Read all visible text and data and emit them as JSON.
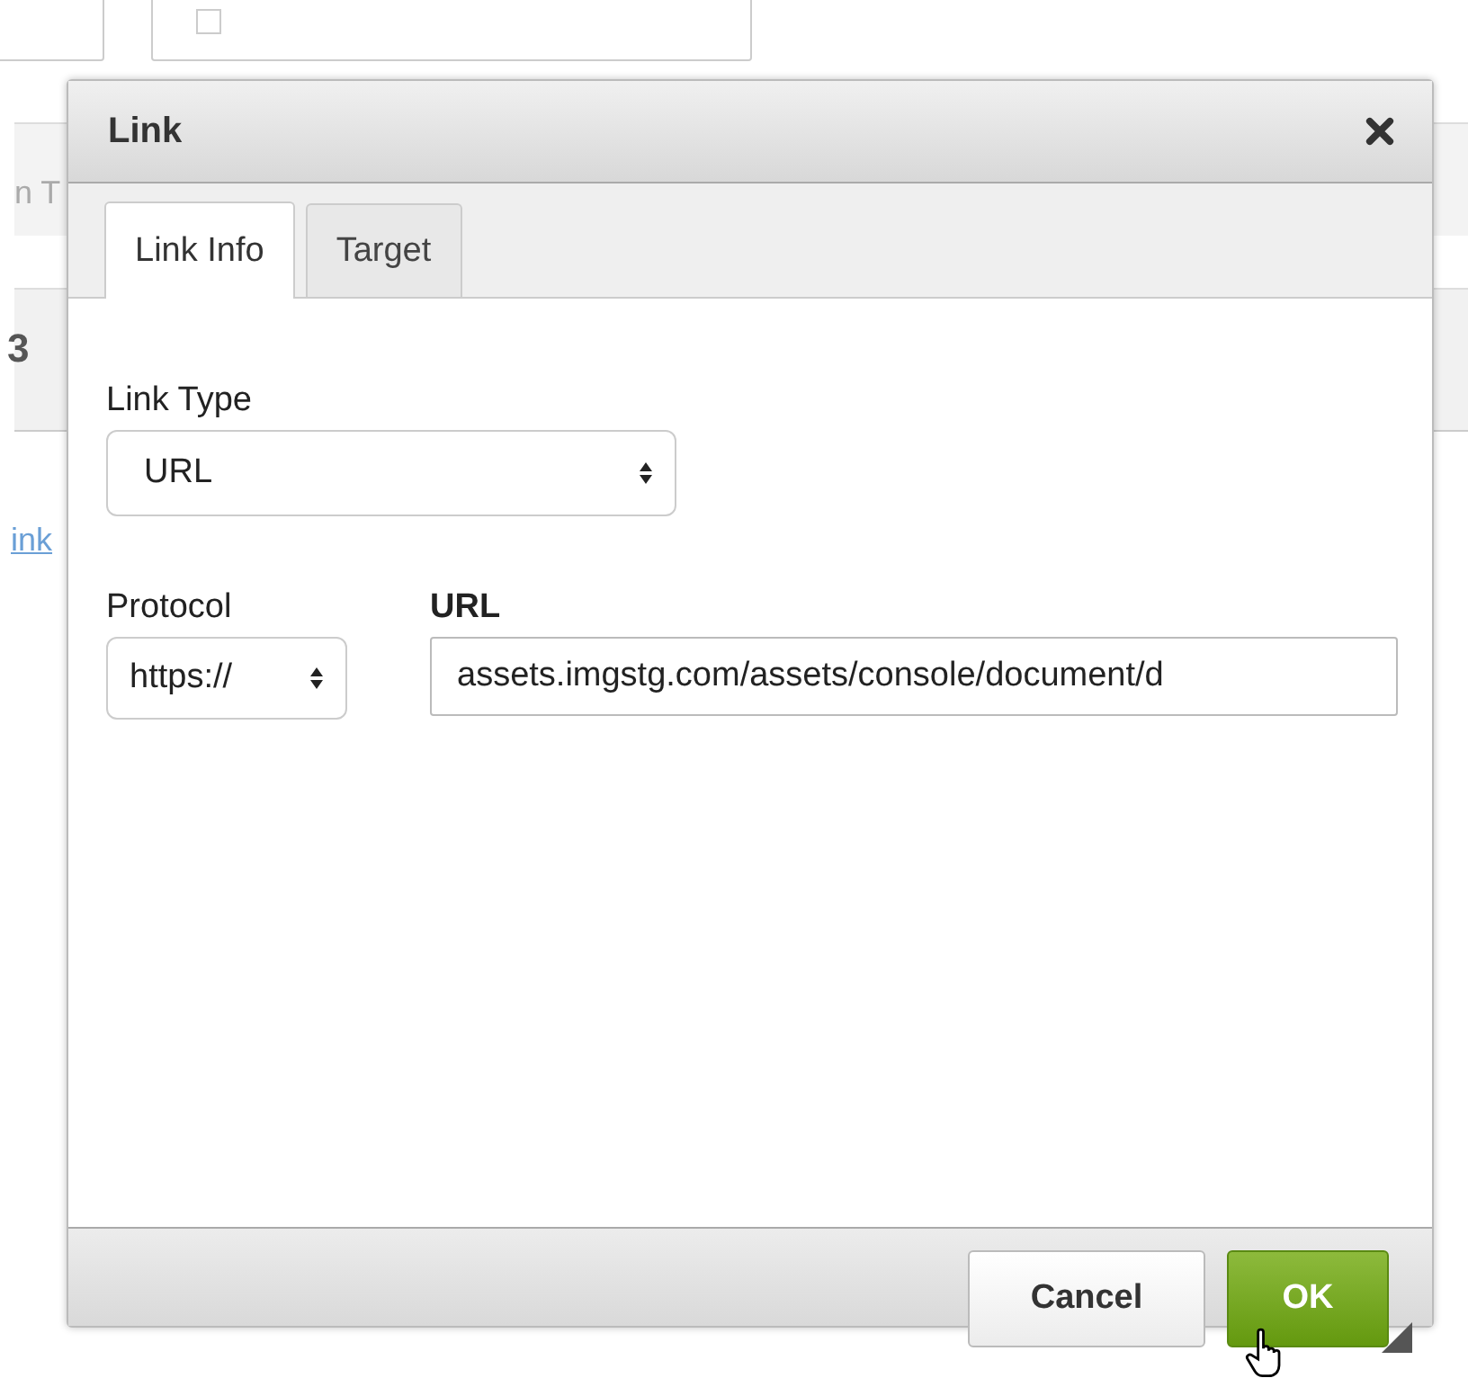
{
  "background": {
    "checkbox": {
      "checked": false
    },
    "toolbar_text": "n T",
    "bold_button": "3",
    "link_text": "ink"
  },
  "dialog": {
    "title": "Link",
    "tabs": [
      {
        "label": "Link Info",
        "selected": true
      },
      {
        "label": "Target",
        "selected": false
      }
    ],
    "link_type": {
      "label": "Link Type",
      "value": "URL"
    },
    "protocol": {
      "label": "Protocol",
      "value": "https://"
    },
    "url": {
      "label": "URL",
      "value": "assets.imgstg.com/assets/console/document/d"
    },
    "buttons": [
      {
        "label": "Cancel",
        "kind": "secondary"
      },
      {
        "label": "OK",
        "kind": "primary"
      }
    ]
  }
}
